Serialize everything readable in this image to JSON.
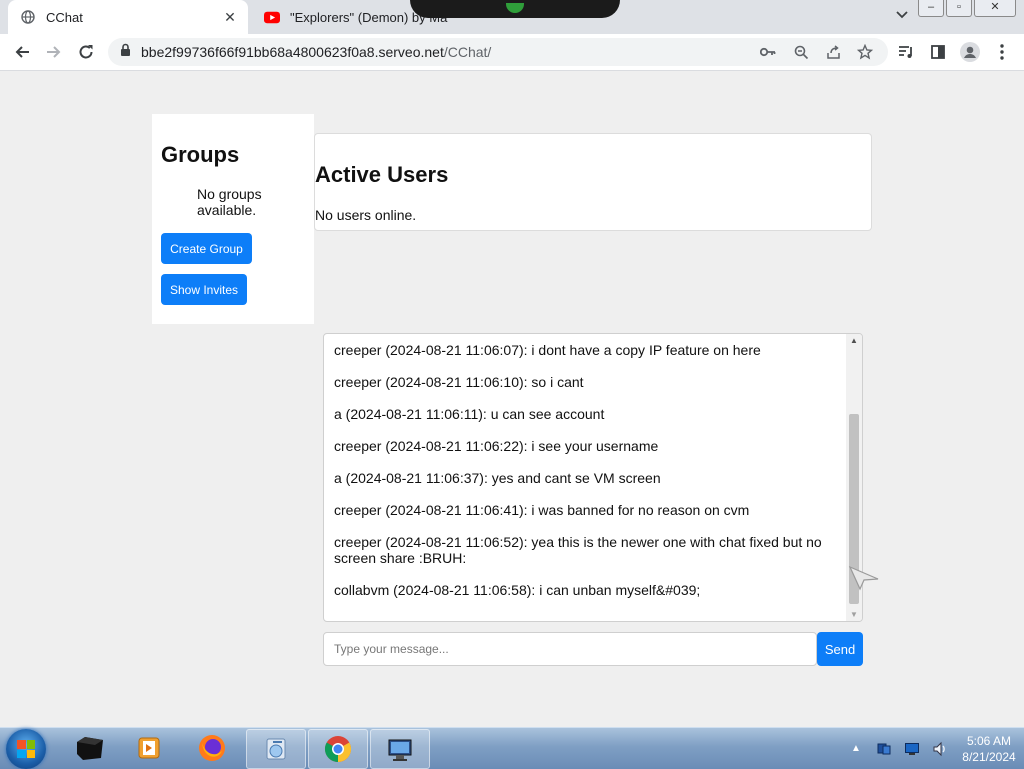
{
  "browser": {
    "tabs": [
      {
        "title": "CChat",
        "active": true
      },
      {
        "title": "\"Explorers\" (Demon) by Ma",
        "active": false
      }
    ],
    "url_host": "bbe2f99736f66f91bb68a4800623f0a8.serveo.net",
    "url_path": "/CChat/"
  },
  "groups": {
    "heading": "Groups",
    "empty_text": "No groups available.",
    "create_label": "Create Group",
    "invites_label": "Show Invites"
  },
  "users": {
    "heading": "Active Users",
    "empty_text": "No users online."
  },
  "chat": {
    "messages": [
      "creeper (2024-08-21 11:06:07): i dont have a copy IP feature on here",
      "creeper (2024-08-21 11:06:10): so i cant",
      "a (2024-08-21 11:06:11): u can see account",
      "creeper (2024-08-21 11:06:22): i see your username",
      "a (2024-08-21 11:06:37): yes and cant se VM screen",
      "creeper (2024-08-21 11:06:41): i was banned for no reason on cvm",
      "creeper (2024-08-21 11:06:52): yea this is the newer one with chat fixed but no screen share :BRUH:",
      "collabvm (2024-08-21 11:06:58): i can unban myself&#039;"
    ],
    "input_placeholder": "Type your message...",
    "send_label": "Send"
  },
  "taskbar": {
    "time": "5:06 AM",
    "date": "8/21/2024"
  },
  "colors": {
    "accent": "#0d7ef8",
    "page_bg": "#efefef"
  }
}
